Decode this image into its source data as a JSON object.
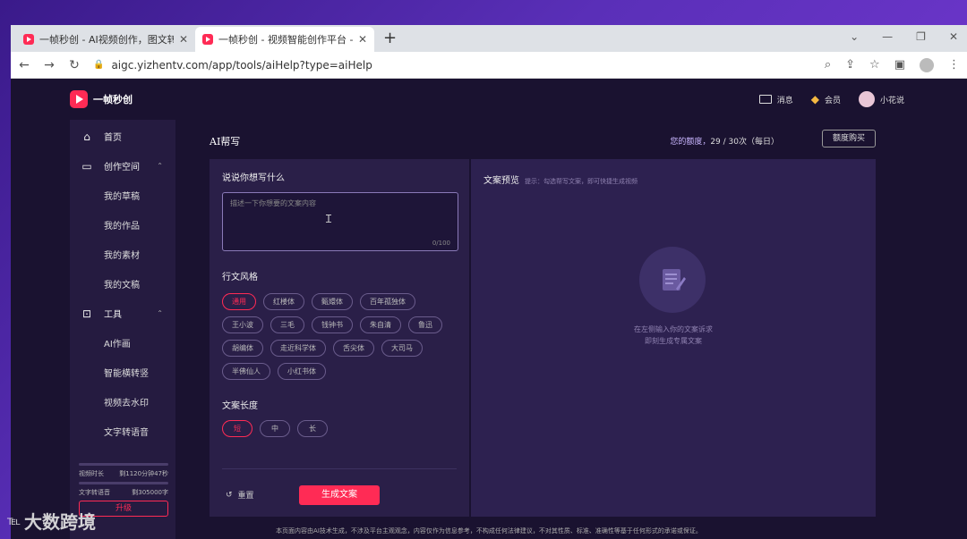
{
  "browser": {
    "tabs": [
      {
        "title": "一帧秒创 - AI视频创作，图文转",
        "active": false
      },
      {
        "title": "一帧秒创 - 视频智能创作平台 - /",
        "active": true
      }
    ],
    "new_tab": "+",
    "url": "aigc.yizhentv.com/app/tools/aiHelp?type=aiHelp"
  },
  "header": {
    "brand": "一帧秒创",
    "messages": "消息",
    "member": "会员",
    "username": "小花说"
  },
  "sidebar": {
    "items": [
      {
        "label": "首页",
        "icon": "home-icon"
      },
      {
        "label": "创作空间",
        "icon": "monitor-icon"
      },
      {
        "label": "我的草稿"
      },
      {
        "label": "我的作品"
      },
      {
        "label": "我的素材"
      },
      {
        "label": "我的文稿"
      },
      {
        "label": "工具",
        "icon": "toolbox-icon"
      },
      {
        "label": "AI作画"
      },
      {
        "label": "智能横转竖"
      },
      {
        "label": "视频去水印"
      },
      {
        "label": "文字转语音"
      }
    ],
    "quota": {
      "video_label": "视频时长",
      "video_value": "剩1120分钟47秒",
      "tts_label": "文字转语音",
      "tts_value": "剩305000字",
      "buy": "升级"
    }
  },
  "main": {
    "title": "AI帮写",
    "usage_prefix": "您的额度，",
    "usage_value": "29 / 30次（每日）",
    "buy_button": "额度购买",
    "input_title": "说说你想写什么",
    "input_placeholder": "描述一下你想要的文案内容",
    "input_counter": "0/100",
    "style_title": "行文风格",
    "styles": [
      "通用",
      "红楼体",
      "甄嬛体",
      "百年孤独体",
      "王小波",
      "三毛",
      "钱钟书",
      "朱自清",
      "鲁迅",
      "胡编体",
      "走近科学体",
      "舌尖体",
      "大司马",
      "半佛仙人",
      "小红书体"
    ],
    "style_selected": "通用",
    "length_title": "文案长度",
    "lengths": [
      "短",
      "中",
      "长"
    ],
    "length_selected": "短",
    "reset": "重置",
    "generate": "生成文案",
    "preview_title": "文案预览",
    "preview_hint": "提示：勾选帮写文案，即可快捷生成视频",
    "empty_line1": "在左侧输入你的文案诉求",
    "empty_line2": "即刻生成专属文案",
    "disclaimer": "本页面内容由AI技术生成，不涉及平台主观观念，内容仅作为信息参考，不构成任何法律建议，不对其性质、标准、准确性等基于任何形式的承诺或保证。"
  },
  "watermark": {
    "text": "大数跨境",
    "logo": "℡"
  },
  "colors": {
    "accent": "#ff2b55",
    "bg": "#1a1230",
    "panel": "#2a1f48"
  }
}
